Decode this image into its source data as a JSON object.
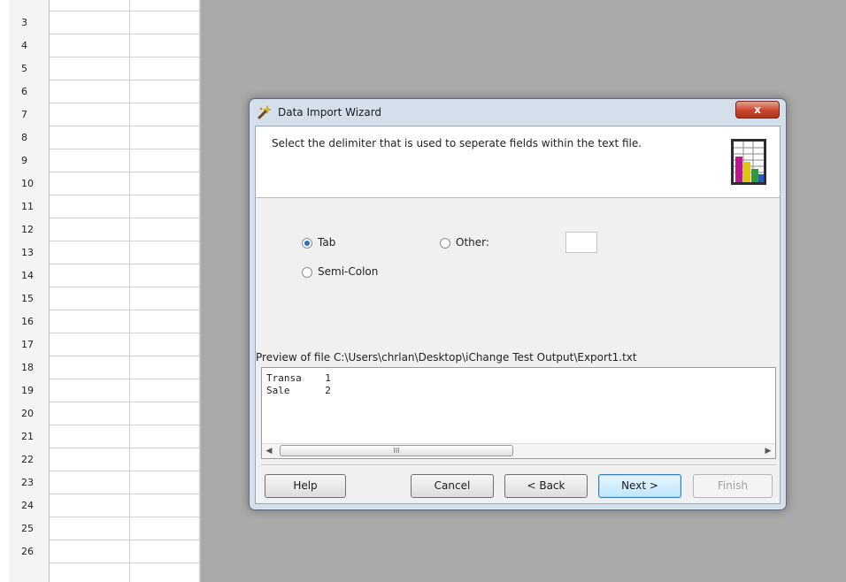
{
  "spreadsheet": {
    "row_numbers": [
      "",
      "3",
      "4",
      "5",
      "6",
      "7",
      "8",
      "9",
      "10",
      "11",
      "12",
      "13",
      "14",
      "15",
      "16",
      "17",
      "18",
      "19",
      "20",
      "21",
      "22",
      "23",
      "24",
      "25",
      "26",
      ""
    ]
  },
  "dialog": {
    "title": "Data Import Wizard",
    "close_label": "x",
    "instruction": "Select the delimiter that is used to seperate fields within the text file.",
    "options": {
      "tab": {
        "label": "Tab",
        "checked": true
      },
      "other": {
        "label": "Other:",
        "checked": false,
        "value": ""
      },
      "semicolon": {
        "label": "Semi-Colon",
        "checked": false
      }
    },
    "preview_label": "Preview of file C:\\Users\\chrlan\\Desktop\\iChange Test Output\\Export1.txt",
    "preview_lines": [
      "Transa    1",
      "Sale      2"
    ],
    "scroll_thumb_grip": "III",
    "buttons": {
      "help": "Help",
      "cancel": "Cancel",
      "back": "< Back",
      "next": "Next >",
      "finish": "Finish"
    }
  },
  "icons": {
    "title_icon": "wizard-wand-icon",
    "header_graphic": "spreadsheet-chart-icon"
  },
  "colors": {
    "workspace": "#a9a9a9",
    "dialog_frame": "#d5dfeb",
    "close_button": "#c8452b",
    "default_button": "#bee6fd"
  }
}
